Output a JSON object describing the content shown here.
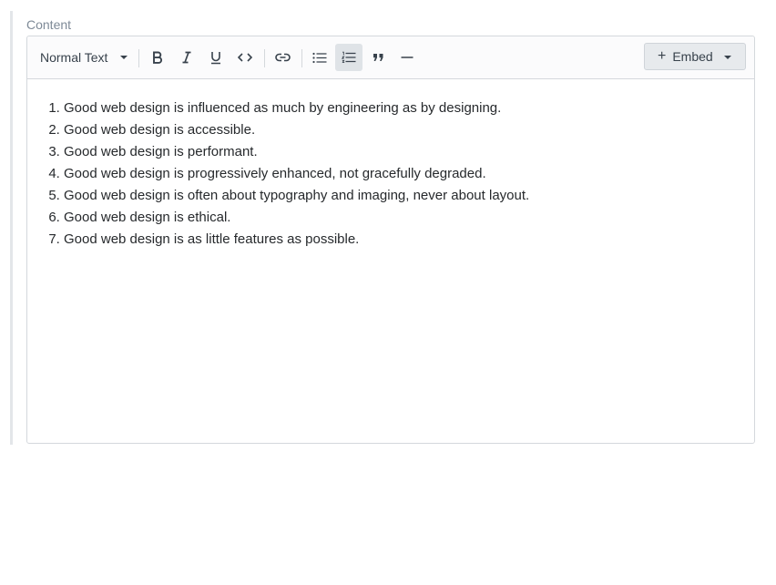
{
  "field": {
    "label": "Content"
  },
  "toolbar": {
    "format_label": "Normal Text",
    "buttons": [
      {
        "name": "bold",
        "icon": "bold-icon",
        "active": false
      },
      {
        "name": "italic",
        "icon": "italic-icon",
        "active": false
      },
      {
        "name": "underline",
        "icon": "underline-icon",
        "active": false
      },
      {
        "name": "code",
        "icon": "code-icon",
        "active": false
      },
      {
        "name": "link",
        "icon": "link-icon",
        "active": false
      },
      {
        "name": "bulleted-list",
        "icon": "bulleted-list-icon",
        "active": false
      },
      {
        "name": "numbered-list",
        "icon": "numbered-list-icon",
        "active": true
      },
      {
        "name": "blockquote",
        "icon": "quote-icon",
        "active": false
      },
      {
        "name": "horizontal-rule",
        "icon": "horizontal-rule-icon",
        "active": false
      }
    ],
    "embed_label": "Embed",
    "embed_prefix": "+"
  },
  "content": {
    "items": [
      "Good web design is influenced as much by engineering as by designing.",
      "Good web design is accessible.",
      "Good web design is performant.",
      "Good web design is progressively enhanced, not gracefully degraded.",
      "Good web design is often about typography and imaging, never about layout.",
      "Good web design is ethical.",
      "Good web design is as little features as possible."
    ]
  },
  "colors": {
    "active_button_bg": "#dfe3e7",
    "border": "#d4d8dc",
    "text": "#26292c",
    "label": "#7e8a97"
  }
}
